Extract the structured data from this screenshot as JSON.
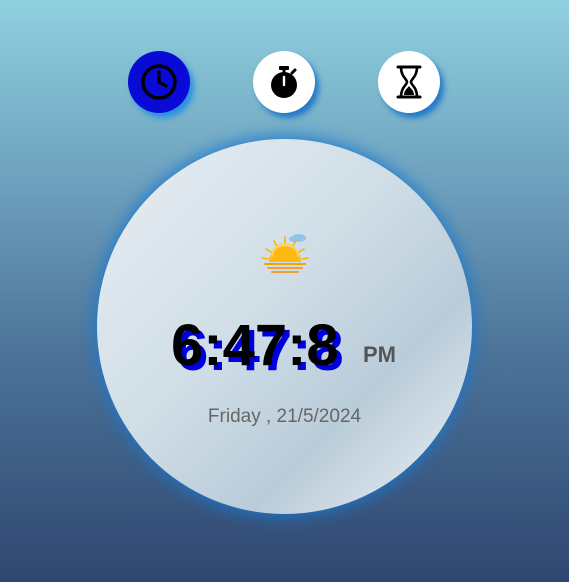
{
  "modes": [
    {
      "name": "clock",
      "icon": "clock-icon",
      "active": true
    },
    {
      "name": "stopwatch",
      "icon": "stopwatch-icon",
      "active": false
    },
    {
      "name": "timer",
      "icon": "hourglass-icon",
      "active": false
    }
  ],
  "clock": {
    "time": "6:47:8",
    "period": "PM",
    "date": "Friday , 21/5/2024",
    "weather_icon": "sunset-icon"
  },
  "colors": {
    "active_button": "#0a0ad6",
    "time_shadow": "#0000dd",
    "glow": "#1e8ce6"
  }
}
